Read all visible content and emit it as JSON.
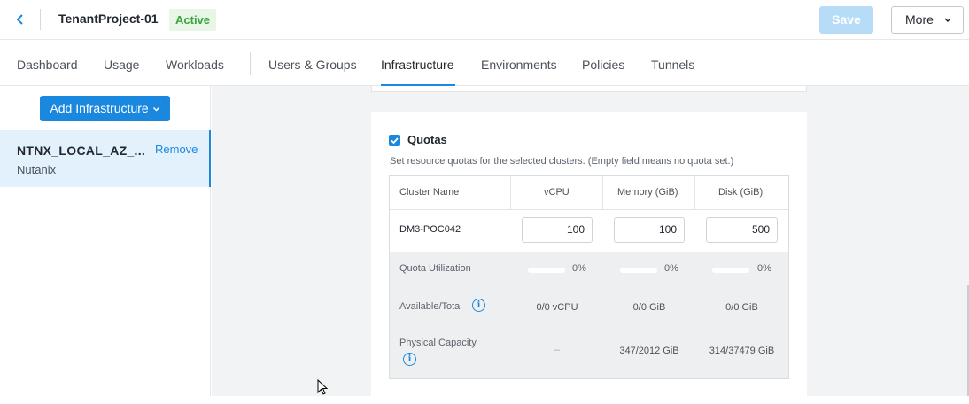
{
  "header": {
    "project_name": "TenantProject-01",
    "status_badge": "Active",
    "save_label": "Save",
    "more_label": "More"
  },
  "tabs": [
    {
      "label": "Dashboard"
    },
    {
      "label": "Usage"
    },
    {
      "label": "Workloads"
    },
    {
      "label": "Users & Groups"
    },
    {
      "label": "Infrastructure",
      "active": true
    },
    {
      "label": "Environments"
    },
    {
      "label": "Policies"
    },
    {
      "label": "Tunnels"
    }
  ],
  "sidebar": {
    "add_button_label": "Add Infrastructure",
    "items": [
      {
        "name": "NTNX_LOCAL_AZ_...",
        "type": "Nutanix",
        "action": "Remove"
      }
    ]
  },
  "quotas": {
    "title": "Quotas",
    "checked": true,
    "description": "Set resource quotas for the selected clusters. (Empty field means no quota set.)",
    "columns": [
      "Cluster Name",
      "vCPU",
      "Memory (GiB)",
      "Disk (GiB)"
    ],
    "cluster": {
      "name": "DM3-POC042",
      "vcpu": "100",
      "memory": "100",
      "disk": "500"
    },
    "utilization": {
      "label": "Quota Utilization",
      "vcpu_pct": "0%",
      "memory_pct": "0%",
      "disk_pct": "0%"
    },
    "available": {
      "label": "Available/Total",
      "vcpu": "0/0 vCPU",
      "memory": "0/0 GiB",
      "disk": "0/0 GiB"
    },
    "physical": {
      "label": "Physical Capacity",
      "vcpu": "–",
      "memory": "347/2012 GiB",
      "disk": "314/37479 GiB"
    }
  },
  "colors": {
    "accent": "#1b88e0",
    "active_badge_bg": "#e7f6e7",
    "active_badge_text": "#3aa53a",
    "save_disabled": "#b6dcf7"
  }
}
